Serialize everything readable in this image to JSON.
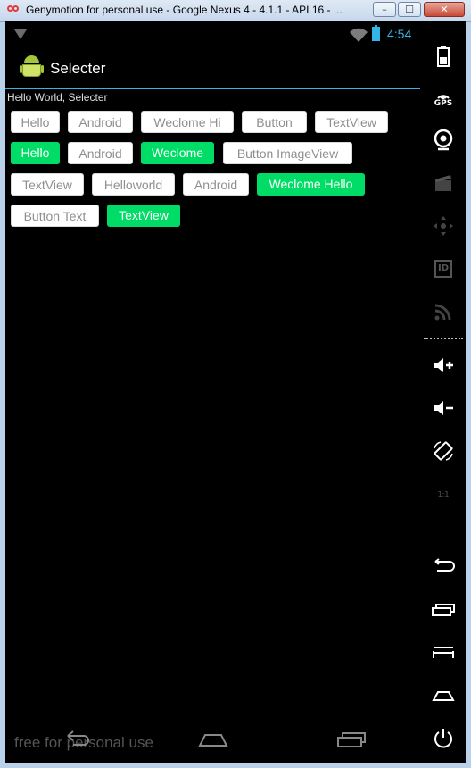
{
  "window": {
    "title": "Genymotion for personal use - Google Nexus 4 - 4.1.1 - API 16 - ...",
    "minimize_label": "–",
    "maximize_label": "☐",
    "close_label": "✕"
  },
  "statusbar": {
    "time": "4:54"
  },
  "app": {
    "title": "Selecter",
    "hello_text": "Hello World, Selecter"
  },
  "tags": [
    {
      "label": "Hello",
      "selected": false
    },
    {
      "label": "Android",
      "selected": false
    },
    {
      "label": "Weclome Hi",
      "selected": false
    },
    {
      "label": "Button",
      "selected": false
    },
    {
      "label": "TextView",
      "selected": false
    },
    {
      "label": "Hello",
      "selected": true
    },
    {
      "label": "Android",
      "selected": false
    },
    {
      "label": "Weclome",
      "selected": true
    },
    {
      "label": "Button ImageView",
      "selected": false
    },
    {
      "label": "TextView",
      "selected": false
    },
    {
      "label": "Helloworld",
      "selected": false
    },
    {
      "label": "Android",
      "selected": false
    },
    {
      "label": "Weclome Hello",
      "selected": true
    },
    {
      "label": "Button Text",
      "selected": false
    },
    {
      "label": "TextView",
      "selected": true
    }
  ],
  "navbar": {
    "watermark": "free for personal use"
  },
  "sidebar": {
    "gps_label": "GPS",
    "id_label": "ID",
    "ratio_label": "1:1"
  },
  "colors": {
    "selected_tag": "#00dd66",
    "accent": "#33b5e5"
  }
}
